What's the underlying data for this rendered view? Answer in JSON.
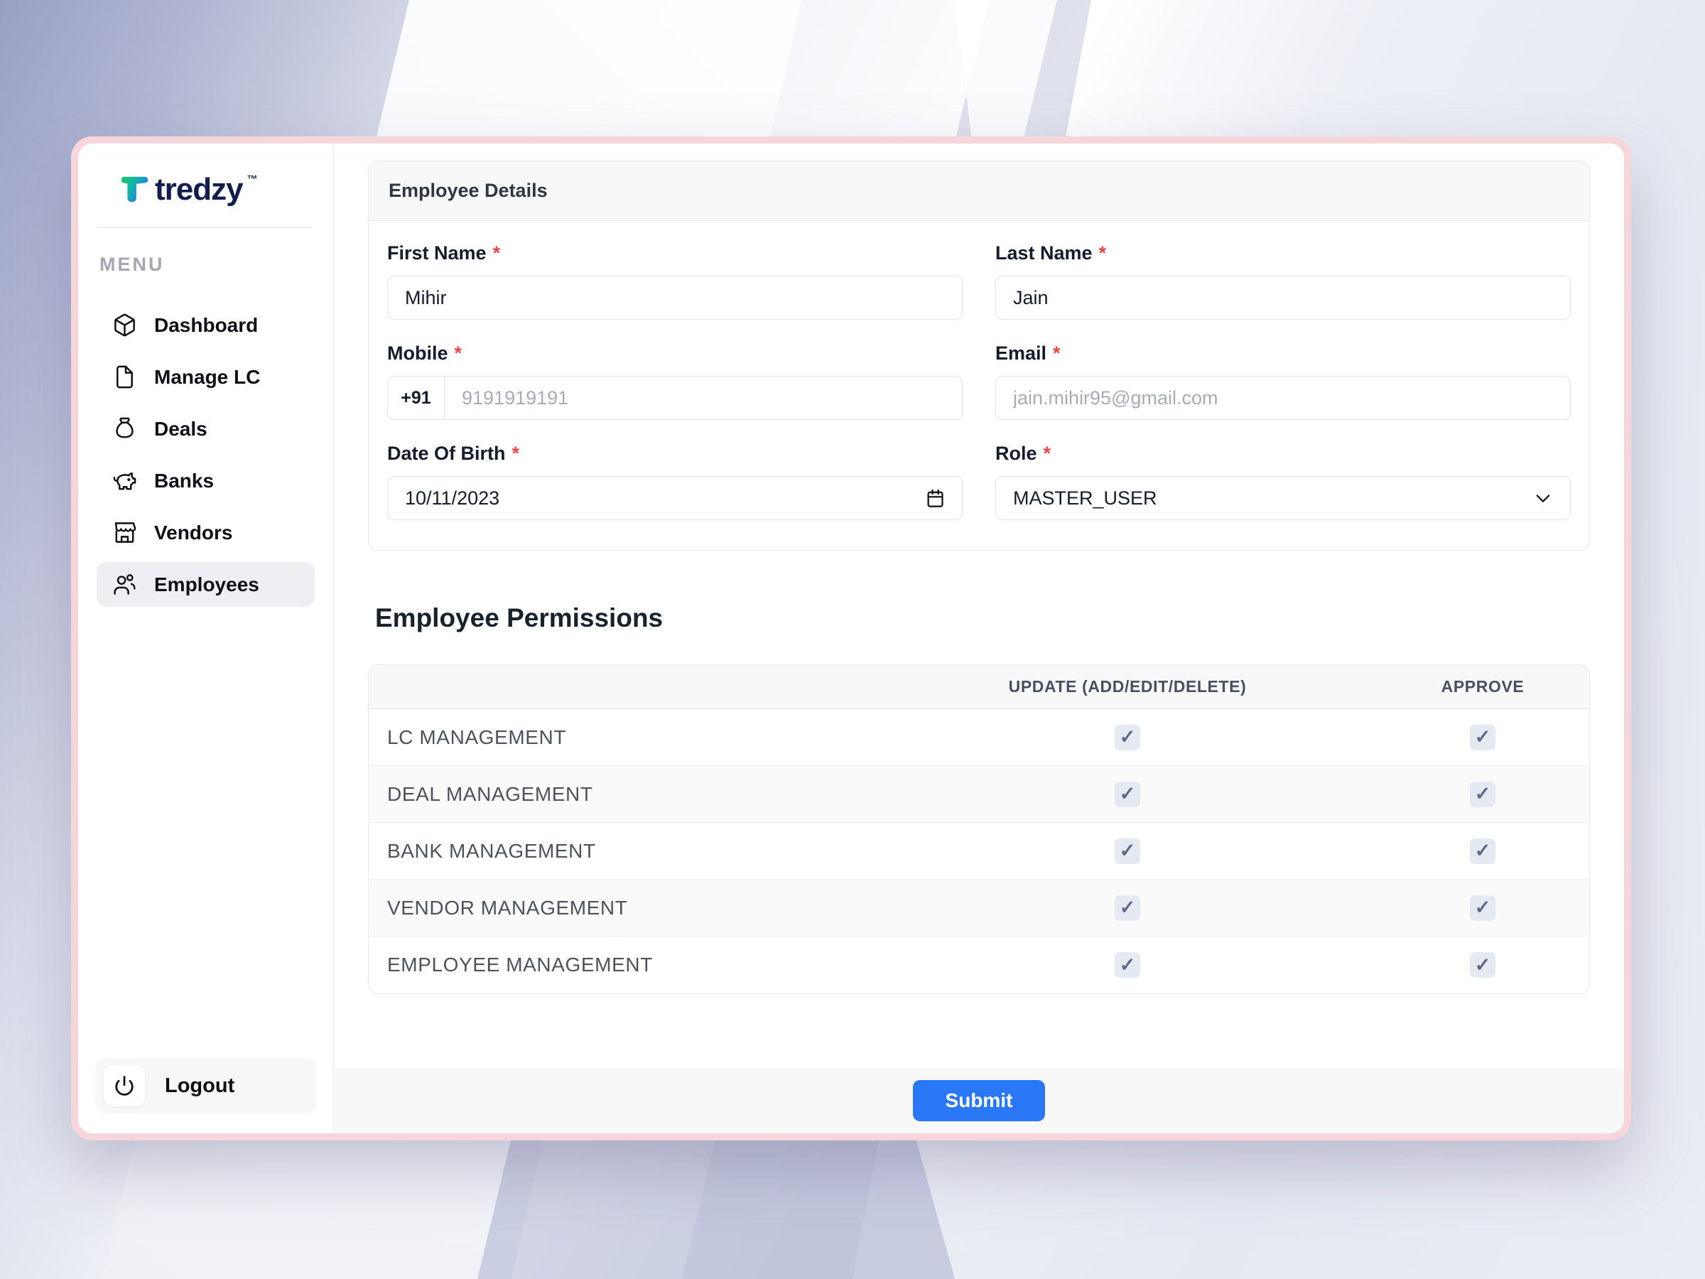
{
  "logo": {
    "brand": "tredzy",
    "tm": "™"
  },
  "sidebar": {
    "menu_label": "MENU",
    "items": [
      {
        "label": "Dashboard",
        "icon": "cube-icon",
        "active": false
      },
      {
        "label": "Manage LC",
        "icon": "file-icon",
        "active": false
      },
      {
        "label": "Deals",
        "icon": "money-bag-icon",
        "active": false
      },
      {
        "label": "Banks",
        "icon": "piggy-bank-icon",
        "active": false
      },
      {
        "label": "Vendors",
        "icon": "storefront-icon",
        "active": false
      },
      {
        "label": "Employees",
        "icon": "users-icon",
        "active": true
      }
    ],
    "logout_label": "Logout"
  },
  "details": {
    "title": "Employee Details",
    "fields": {
      "first_name": {
        "label": "First Name",
        "required": "*",
        "value": "Mihir"
      },
      "last_name": {
        "label": "Last Name",
        "required": "*",
        "value": "Jain"
      },
      "mobile": {
        "label": "Mobile",
        "required": "*",
        "prefix": "+91",
        "placeholder": "9191919191"
      },
      "email": {
        "label": "Email",
        "required": "*",
        "placeholder": "jain.mihir95@gmail.com"
      },
      "dob": {
        "label": "Date Of Birth",
        "required": "*",
        "value": "10/11/2023"
      },
      "role": {
        "label": "Role",
        "required": "*",
        "value": "MASTER_USER"
      }
    }
  },
  "permissions": {
    "title": "Employee Permissions",
    "columns": [
      "UPDATE (ADD/EDIT/DELETE)",
      "APPROVE"
    ],
    "check_glyph": "✓",
    "rows": [
      {
        "label": "LC MANAGEMENT",
        "update": true,
        "approve": true
      },
      {
        "label": "DEAL MANAGEMENT",
        "update": true,
        "approve": true
      },
      {
        "label": "BANK MANAGEMENT",
        "update": true,
        "approve": true
      },
      {
        "label": "VENDOR MANAGEMENT",
        "update": true,
        "approve": true
      },
      {
        "label": "EMPLOYEE MANAGEMENT",
        "update": true,
        "approve": true
      }
    ]
  },
  "footer": {
    "submit_label": "Submit"
  },
  "colors": {
    "accent_blue": "#2b78f7",
    "card_border_pink": "#f6d6da",
    "brand_navy": "#131c4e",
    "checkbox_bg": "#e5eaf2",
    "checkbox_check": "#5b6b85",
    "active_item_bg": "#efeff3"
  }
}
